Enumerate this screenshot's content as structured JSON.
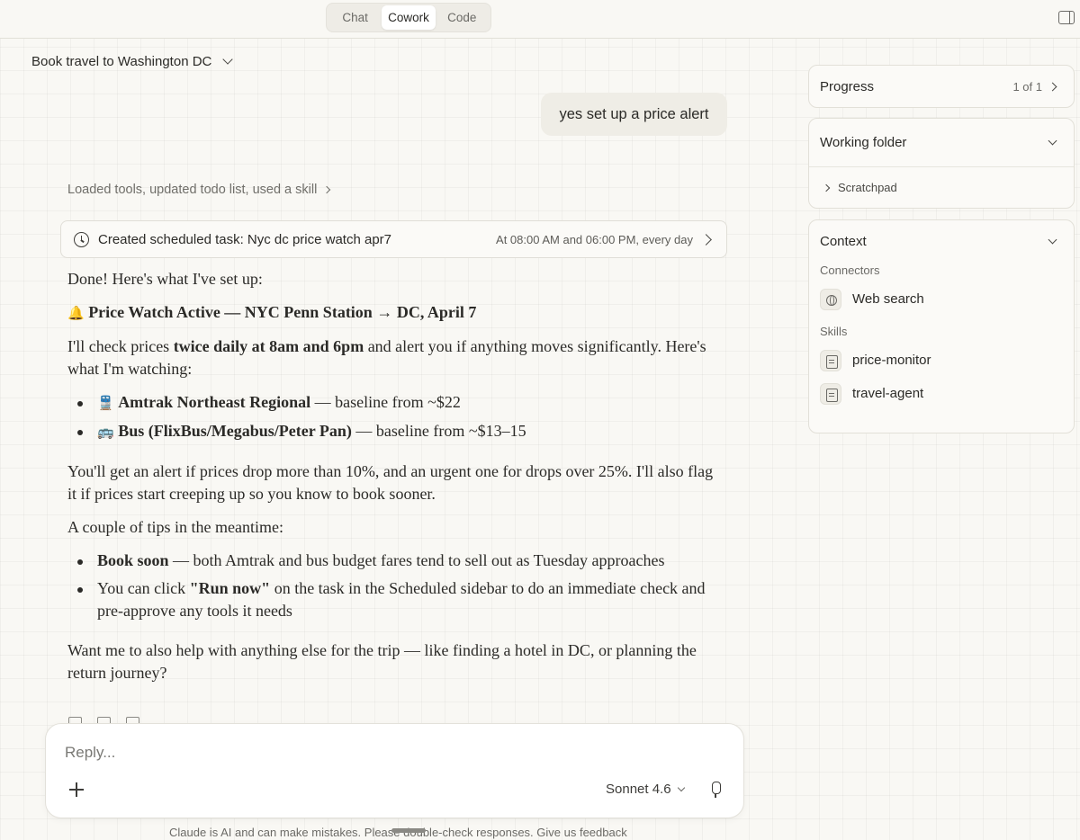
{
  "mode_switch": {
    "tabs": [
      "Chat",
      "Cowork",
      "Code"
    ],
    "active": "Cowork"
  },
  "thread": {
    "title": "Book travel to Washington DC"
  },
  "user_message": "yes set up a price alert",
  "tools_summary": "Loaded tools, updated todo list, used a skill",
  "scheduled_task": {
    "title": "Created scheduled task: Nyc dc price watch apr7",
    "schedule": "At 08:00 AM and 06:00 PM, every day"
  },
  "assistant": {
    "intro": "Done! Here's what I've set up:",
    "heading_emoji": "🔔",
    "heading": "Price Watch Active — NYC Penn Station → DC, April 7",
    "check_pre": "I'll check prices ",
    "check_bold": "twice daily at 8am and 6pm",
    "check_post": " and alert you if anything moves significantly. Here's what I'm watching:",
    "watch_items": [
      {
        "emoji": "🚆",
        "bold": "Amtrak Northeast Regional",
        "rest": " — baseline from ~$22"
      },
      {
        "emoji": "🚌",
        "bold": "Bus (FlixBus/Megabus/Peter Pan)",
        "rest": " — baseline from ~$13–15"
      }
    ],
    "alert_text": "You'll get an alert if prices drop more than 10%, and an urgent one for drops over 25%. I'll also flag it if prices start creeping up so you know to book sooner.",
    "tips_intro": "A couple of tips in the meantime:",
    "tip1_bold": "Book soon",
    "tip1_rest": " — both Amtrak and bus budget fares tend to sell out as Tuesday approaches",
    "tip2_pre": "You can click ",
    "tip2_bold": "\"Run now\"",
    "tip2_post": " on the task in the Scheduled sidebar to do an immediate check and pre-approve any tools it needs",
    "closing": "Want me to also help with anything else for the trip — like finding a hotel in DC, or planning the return journey?"
  },
  "composer": {
    "placeholder": "Reply...",
    "model": "Sonnet 4.6"
  },
  "disclaimer": "Claude is AI and can make mistakes. Please double-check responses. Give us feedback",
  "sidebar": {
    "progress": {
      "label": "Progress",
      "count": "1 of 1"
    },
    "working_folder": {
      "label": "Working folder",
      "item": "Scratchpad"
    },
    "context": {
      "label": "Context",
      "connectors_label": "Connectors",
      "connectors": [
        "Web search"
      ],
      "skills_label": "Skills",
      "skills": [
        "price-monitor",
        "travel-agent"
      ]
    }
  }
}
